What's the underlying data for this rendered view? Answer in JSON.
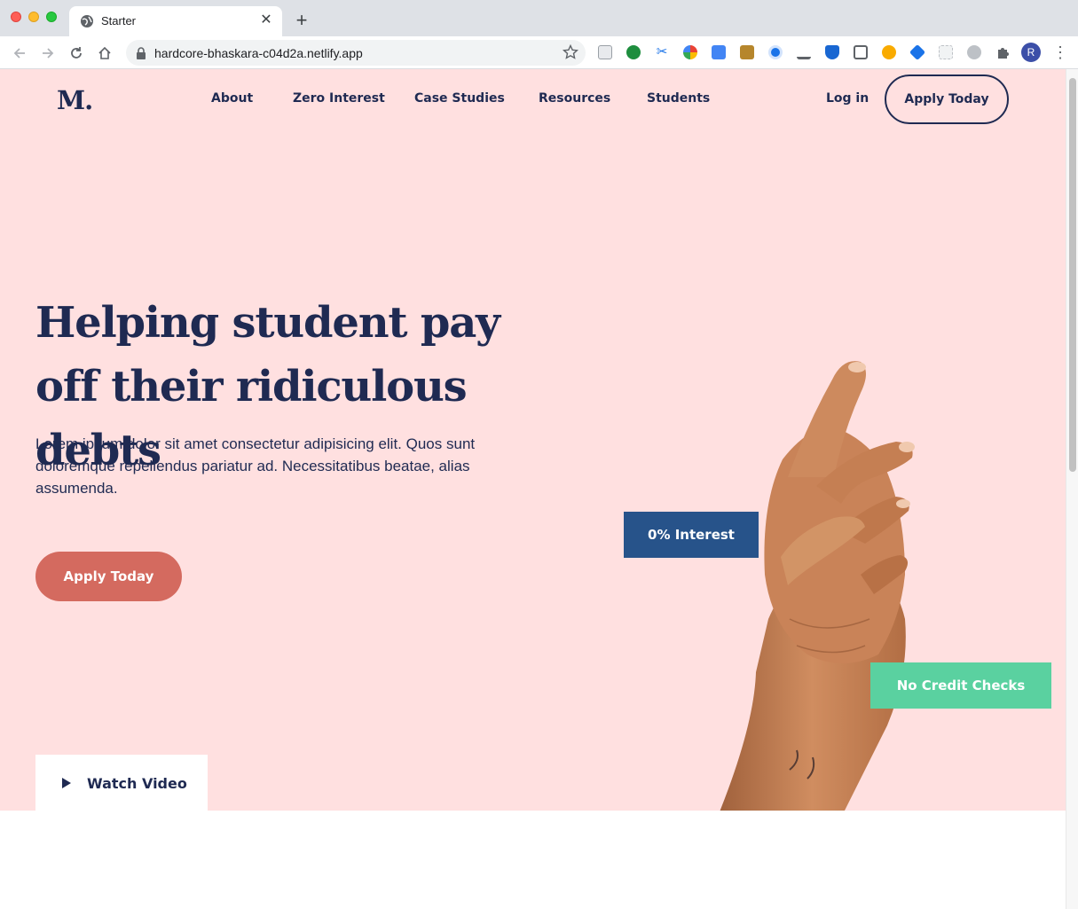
{
  "browser": {
    "tab_title": "Starter",
    "tab_close": "✕",
    "new_tab": "+",
    "url": "hardcore-bhaskara-c04d2a.netlify.app",
    "profile_initial": "R",
    "menu_glyph": "⋮",
    "extension_icons": [
      "ext-media-icon",
      "ext-check-icon",
      "ext-scissors-icon",
      "ext-chrome-circle-icon",
      "ext-translate-icon",
      "ext-film-icon",
      "ext-compass-icon",
      "ext-laptop-icon",
      "ext-shield-icon",
      "ext-news-icon",
      "ext-key-icon",
      "ext-heart-icon",
      "ext-grid-icon",
      "ext-gray-circle-icon",
      "ext-puzzle-icon"
    ]
  },
  "site": {
    "logo": "M.",
    "nav": {
      "links": [
        "About",
        "Zero Interest",
        "Case Studies",
        "Resources",
        "Students"
      ],
      "login": "Log in",
      "apply": "Apply Today"
    },
    "hero": {
      "headline_line1": "Helping student pay",
      "headline_line2": "off their ridiculous debts",
      "subtext": "Lorem ipsum dolor sit amet consectetur adipisicing elit. Quos sunt doloremque repellendus pariatur ad. Necessitatibus beatae, alias assumenda.",
      "cta": "Apply Today",
      "watch_video": "Watch Video",
      "badge_interest": "0% Interest",
      "badge_credit": "No Credit Checks"
    }
  },
  "colors": {
    "hero_bg": "#ffe0e0",
    "navy": "#1f2a52",
    "cta_coral": "#d46a5f",
    "badge_blue": "#27538a",
    "badge_green": "#5ad1a0",
    "skin": "#c98358"
  }
}
